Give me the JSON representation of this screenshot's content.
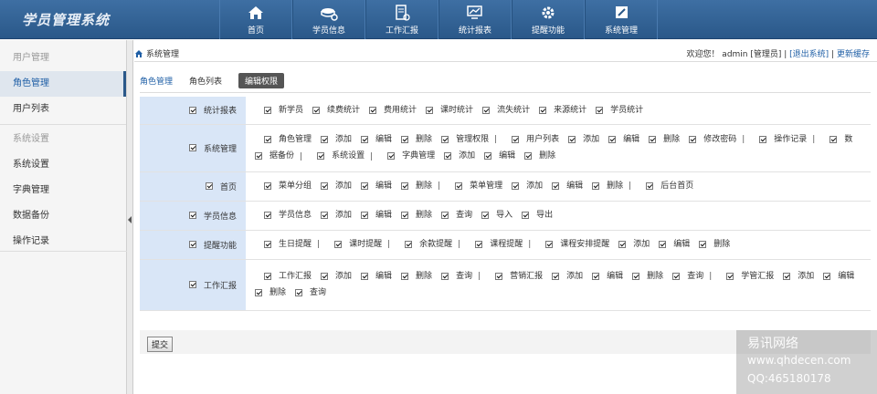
{
  "app": {
    "title": "学员管理系统"
  },
  "nav": [
    {
      "label": "首页",
      "icon": "home-icon"
    },
    {
      "label": "学员信息",
      "icon": "users-icon"
    },
    {
      "label": "工作汇报",
      "icon": "report-icon"
    },
    {
      "label": "统计报表",
      "icon": "monitor-icon"
    },
    {
      "label": "提醒功能",
      "icon": "gear-icon"
    },
    {
      "label": "系统管理",
      "icon": "edit-icon"
    }
  ],
  "sidebar": {
    "group1": "用户管理",
    "items1": [
      "角色管理",
      "用户列表"
    ],
    "group2": "系统设置",
    "items2": [
      "系统设置",
      "字典管理",
      "数据备份",
      "操作记录"
    ]
  },
  "breadcrumb": {
    "text": "系统管理"
  },
  "userbar": {
    "welcome": "欢迎您！ admin [管理员]",
    "logout": "[退出系统]",
    "refresh": "更新缓存"
  },
  "tabs": [
    "角色管理",
    "角色列表",
    "编辑权限"
  ],
  "permissions": {
    "rows": [
      {
        "cat": "统计报表",
        "lines": [
          [
            [
              "新学员",
              "续费统计",
              "费用统计",
              "课时统计",
              "流失统计",
              "来源统计",
              "学员统计"
            ]
          ]
        ]
      },
      {
        "cat": "系统管理",
        "lines": [
          [
            [
              "角色管理",
              "添加",
              "编辑",
              "删除",
              "管理权限"
            ],
            [
              "用户列表",
              "添加",
              "编辑",
              "删除",
              "修改密码"
            ],
            [
              "操作记录"
            ],
            [
              "数"
            ]
          ],
          [
            [
              "据备份"
            ],
            [
              "系统设置"
            ],
            [
              "字典管理",
              "添加",
              "编辑",
              "删除"
            ]
          ]
        ]
      },
      {
        "cat": "首页",
        "lines": [
          [
            [
              "菜单分组",
              "添加",
              "编辑",
              "删除"
            ],
            [
              "菜单管理",
              "添加",
              "编辑",
              "删除"
            ],
            [
              "后台首页"
            ]
          ]
        ]
      },
      {
        "cat": "学员信息",
        "lines": [
          [
            [
              "学员信息",
              "添加",
              "编辑",
              "删除",
              "查询",
              "导入",
              "导出"
            ]
          ]
        ]
      },
      {
        "cat": "提醒功能",
        "lines": [
          [
            [
              "生日提醒"
            ],
            [
              "课时提醒"
            ],
            [
              "余款提醒"
            ],
            [
              "课程提醒"
            ],
            [
              "课程安排提醒",
              "添加",
              "编辑",
              "删除"
            ]
          ]
        ]
      },
      {
        "cat": "工作汇报",
        "lines": [
          [
            [
              "工作汇报",
              "添加",
              "编辑",
              "删除",
              "查询"
            ],
            [
              "营销汇报",
              "添加",
              "编辑",
              "删除",
              "查询"
            ],
            [
              "学管汇报",
              "添加",
              "编辑"
            ]
          ],
          [
            [
              "删除",
              "查询"
            ]
          ]
        ]
      }
    ]
  },
  "submit": {
    "label": "提交"
  },
  "watermark": {
    "line1": "易讯网络",
    "line2": "www.qhdecen.com",
    "line3": "QQ:465180178"
  },
  "colors": {
    "header": "#2a5889",
    "accent": "#1f5fa6",
    "category_bg": "#d9e6f7"
  }
}
